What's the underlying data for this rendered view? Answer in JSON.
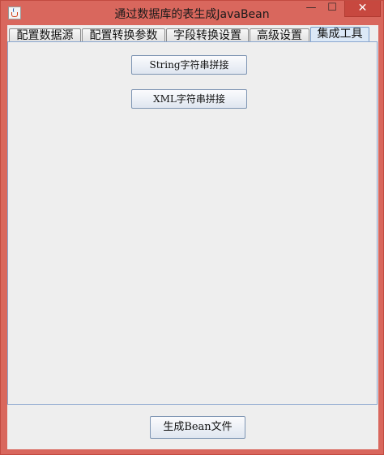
{
  "window": {
    "title": "通过数据库的表生成JavaBean",
    "minimize_glyph": "—",
    "maximize_glyph": "☐",
    "close_glyph": "✕"
  },
  "tabs": [
    {
      "label": "配置数据源",
      "active": false
    },
    {
      "label": "配置转换参数",
      "active": false
    },
    {
      "label": "字段转换设置",
      "active": false
    },
    {
      "label": "高级设置",
      "active": false
    },
    {
      "label": "集成工具",
      "active": true
    }
  ],
  "panel": {
    "buttons": [
      {
        "label": "String字符串拼接"
      },
      {
        "label": "XML字符串拼接"
      }
    ]
  },
  "footer": {
    "generate_label": "生成Bean文件"
  }
}
